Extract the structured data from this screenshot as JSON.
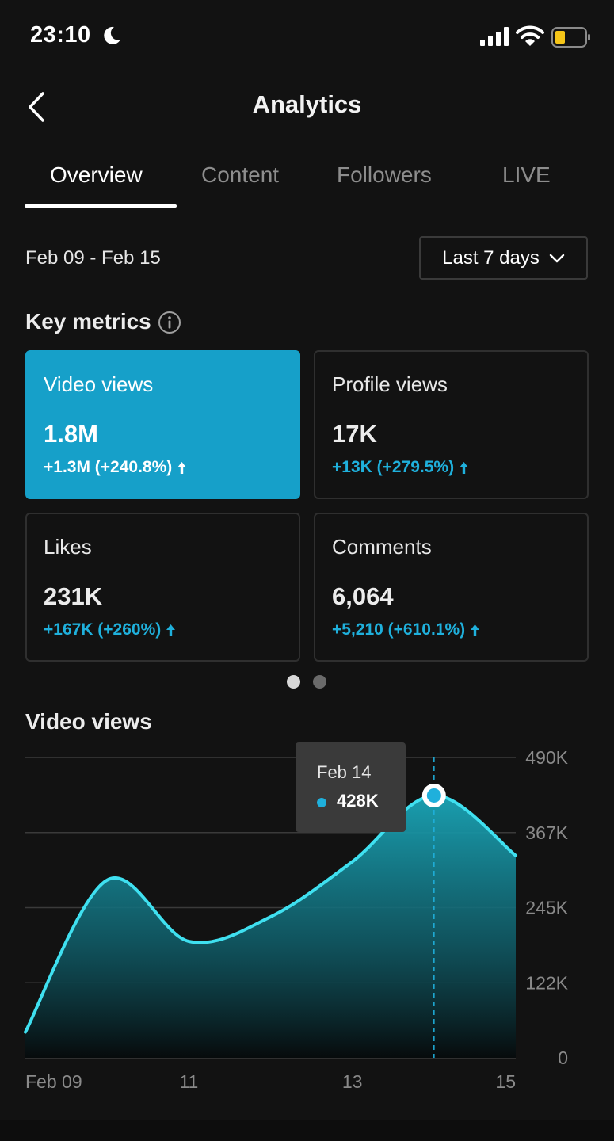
{
  "status_bar": {
    "time": "23:10",
    "icons": [
      "moon-icon",
      "signal-icon",
      "wifi-icon",
      "battery-icon"
    ],
    "battery_color": "#f5c518"
  },
  "header": {
    "back_icon": "chevron-left-icon",
    "title": "Analytics"
  },
  "tabs": [
    {
      "label": "Overview",
      "active": true
    },
    {
      "label": "Content",
      "active": false
    },
    {
      "label": "Followers",
      "active": false
    },
    {
      "label": "LIVE",
      "active": false
    }
  ],
  "date_range": "Feb 09 - Feb 15",
  "range_select": {
    "label": "Last 7 days",
    "icon": "chevron-down-icon"
  },
  "key_metrics": {
    "title": "Key metrics",
    "info_icon": "info-icon",
    "cards": [
      {
        "label": "Video views",
        "value": "1.8M",
        "change": "+1.3M (+240.8%)",
        "selected": true
      },
      {
        "label": "Profile views",
        "value": "17K",
        "change": "+13K (+279.5%)",
        "selected": false
      },
      {
        "label": "Likes",
        "value": "231K",
        "change": "+167K (+260%)",
        "selected": false
      },
      {
        "label": "Comments",
        "value": "6,064",
        "change": "+5,210 (+610.1%)",
        "selected": false
      }
    ],
    "pager": {
      "pages": 2,
      "current": 1
    }
  },
  "video_views_section": {
    "title": "Video views",
    "tooltip": {
      "date": "Feb 14",
      "value": "428K"
    }
  },
  "colors": {
    "accent": "#1fb0dc",
    "selected_card": "#16a0c9",
    "line": "#3fe0f0",
    "background": "#121212"
  },
  "chart_data": {
    "type": "area",
    "x": [
      "Feb 09",
      "Feb 10",
      "Feb 11",
      "Feb 12",
      "Feb 13",
      "Feb 14",
      "Feb 15"
    ],
    "x_tick_labels": [
      "Feb 09",
      "11",
      "13",
      "15"
    ],
    "x_tick_positions": [
      "Feb 09",
      "Feb 11",
      "Feb 13",
      "Feb 15"
    ],
    "values": [
      42000,
      290000,
      190000,
      230000,
      320000,
      428000,
      330000
    ],
    "y_tick_labels": [
      "490K",
      "367K",
      "245K",
      "122K",
      "0"
    ],
    "ylim": [
      0,
      490000
    ],
    "highlight": {
      "x": "Feb 14",
      "value": 428000
    },
    "grid": true,
    "yaxis_position": "right"
  }
}
